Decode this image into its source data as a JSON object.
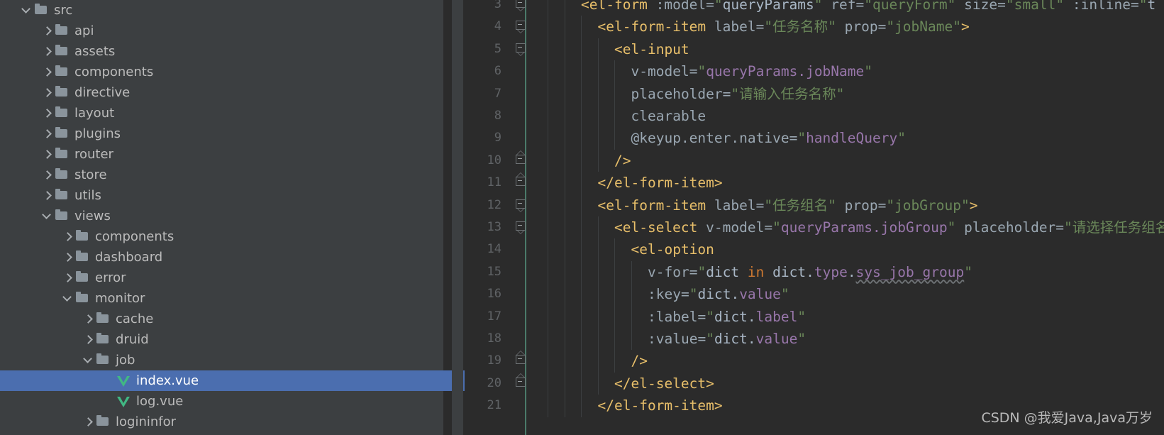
{
  "sidebar": {
    "scrollbar": {
      "present": true
    },
    "tree": [
      {
        "label": "src",
        "depth": 0,
        "chevron": "down",
        "icon": "folder-icon",
        "selected": false
      },
      {
        "label": "api",
        "depth": 1,
        "chevron": "right",
        "icon": "folder-icon",
        "selected": false
      },
      {
        "label": "assets",
        "depth": 1,
        "chevron": "right",
        "icon": "folder-icon",
        "selected": false
      },
      {
        "label": "components",
        "depth": 1,
        "chevron": "right",
        "icon": "folder-icon",
        "selected": false
      },
      {
        "label": "directive",
        "depth": 1,
        "chevron": "right",
        "icon": "folder-icon",
        "selected": false
      },
      {
        "label": "layout",
        "depth": 1,
        "chevron": "right",
        "icon": "folder-icon",
        "selected": false
      },
      {
        "label": "plugins",
        "depth": 1,
        "chevron": "right",
        "icon": "folder-icon",
        "selected": false
      },
      {
        "label": "router",
        "depth": 1,
        "chevron": "right",
        "icon": "folder-icon",
        "selected": false
      },
      {
        "label": "store",
        "depth": 1,
        "chevron": "right",
        "icon": "folder-icon",
        "selected": false
      },
      {
        "label": "utils",
        "depth": 1,
        "chevron": "right",
        "icon": "folder-icon",
        "selected": false
      },
      {
        "label": "views",
        "depth": 1,
        "chevron": "down",
        "icon": "folder-icon",
        "selected": false
      },
      {
        "label": "components",
        "depth": 2,
        "chevron": "right",
        "icon": "folder-icon",
        "selected": false
      },
      {
        "label": "dashboard",
        "depth": 2,
        "chevron": "right",
        "icon": "folder-icon",
        "selected": false
      },
      {
        "label": "error",
        "depth": 2,
        "chevron": "right",
        "icon": "folder-icon",
        "selected": false
      },
      {
        "label": "monitor",
        "depth": 2,
        "chevron": "down",
        "icon": "folder-icon",
        "selected": false
      },
      {
        "label": "cache",
        "depth": 3,
        "chevron": "right",
        "icon": "folder-icon",
        "selected": false
      },
      {
        "label": "druid",
        "depth": 3,
        "chevron": "right",
        "icon": "folder-icon",
        "selected": false
      },
      {
        "label": "job",
        "depth": 3,
        "chevron": "down",
        "icon": "folder-icon",
        "selected": false
      },
      {
        "label": "index.vue",
        "depth": 4,
        "chevron": "none",
        "icon": "vue-file-icon",
        "selected": true
      },
      {
        "label": "log.vue",
        "depth": 4,
        "chevron": "none",
        "icon": "vue-file-icon",
        "selected": false
      },
      {
        "label": "logininfor",
        "depth": 3,
        "chevron": "right",
        "icon": "folder-icon",
        "selected": false
      }
    ]
  },
  "editor": {
    "first_line_number": 3,
    "line_numbers": [
      3,
      4,
      5,
      6,
      7,
      8,
      9,
      10,
      11,
      12,
      13,
      14,
      15,
      16,
      17,
      18,
      19,
      20,
      21
    ],
    "fold_markers": [
      {
        "line": 3,
        "kind": "open"
      },
      {
        "line": 4,
        "kind": "open"
      },
      {
        "line": 5,
        "kind": "open"
      },
      {
        "line": 10,
        "kind": "close"
      },
      {
        "line": 11,
        "kind": "close"
      },
      {
        "line": 12,
        "kind": "open"
      },
      {
        "line": 13,
        "kind": "open"
      },
      {
        "line": 19,
        "kind": "close"
      },
      {
        "line": 20,
        "kind": "close"
      }
    ],
    "lines": [
      {
        "num": 3,
        "indent": 2,
        "text": "<el-form :model=\"queryParams\" ref=\"queryForm\" size=\"small\" :inline=\"t"
      },
      {
        "num": 4,
        "indent": 3,
        "text": "<el-form-item label=\"任务名称\" prop=\"jobName\">"
      },
      {
        "num": 5,
        "indent": 4,
        "text": "<el-input"
      },
      {
        "num": 6,
        "indent": 5,
        "text": "v-model=\"queryParams.jobName\""
      },
      {
        "num": 7,
        "indent": 5,
        "text": "placeholder=\"请输入任务名称\""
      },
      {
        "num": 8,
        "indent": 5,
        "text": "clearable"
      },
      {
        "num": 9,
        "indent": 5,
        "text": "@keyup.enter.native=\"handleQuery\""
      },
      {
        "num": 10,
        "indent": 4,
        "text": "/>"
      },
      {
        "num": 11,
        "indent": 3,
        "text": "</el-form-item>"
      },
      {
        "num": 12,
        "indent": 3,
        "text": "<el-form-item label=\"任务组名\" prop=\"jobGroup\">"
      },
      {
        "num": 13,
        "indent": 4,
        "text": "<el-select v-model=\"queryParams.jobGroup\" placeholder=\"请选择任务组名"
      },
      {
        "num": 14,
        "indent": 5,
        "text": "<el-option"
      },
      {
        "num": 15,
        "indent": 6,
        "text": "v-for=\"dict in dict.type.sys_job_group\""
      },
      {
        "num": 16,
        "indent": 6,
        "text": ":key=\"dict.value\""
      },
      {
        "num": 17,
        "indent": 6,
        "text": ":label=\"dict.label\""
      },
      {
        "num": 18,
        "indent": 6,
        "text": ":value=\"dict.value\""
      },
      {
        "num": 19,
        "indent": 5,
        "text": "/>"
      },
      {
        "num": 20,
        "indent": 4,
        "text": "</el-select>"
      },
      {
        "num": 21,
        "indent": 3,
        "text": "</el-form-item>"
      }
    ]
  },
  "watermark": {
    "text": "CSDN @我爱Java,Java万岁"
  },
  "colors": {
    "sidebar_bg": "#3c3f41",
    "editor_bg": "#2b2b2b",
    "selection_blue": "#4b6eaf",
    "tag_orange": "#e8bf6a",
    "string_green": "#6a8759",
    "expression_purple": "#9876aa",
    "keyword_orange": "#cc7832",
    "attr_gray": "#9aa7b2",
    "vue_green": "#41b883",
    "vcs_teal": "#4a7a6a"
  }
}
